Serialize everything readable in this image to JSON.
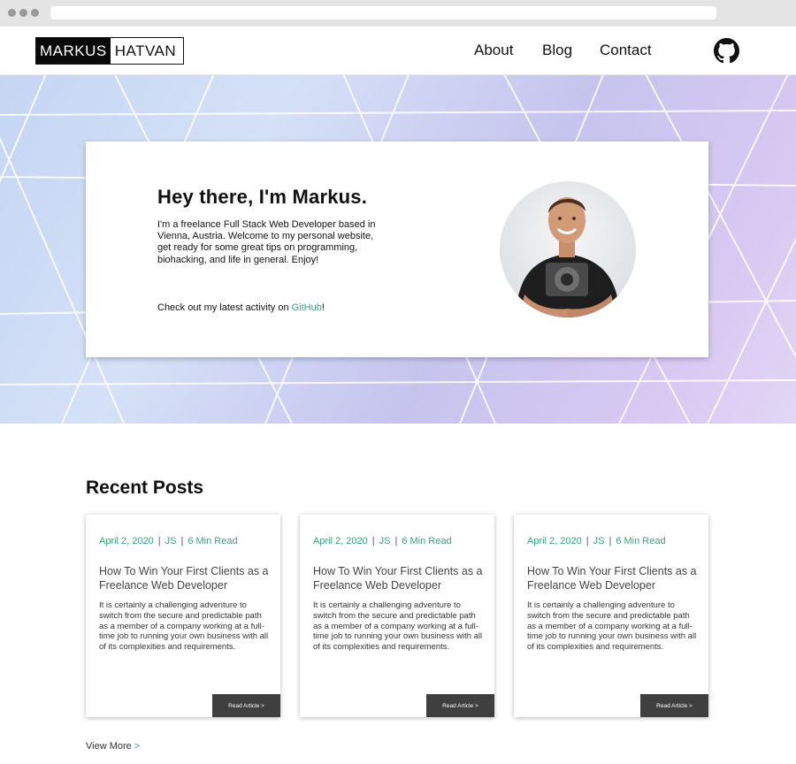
{
  "header": {
    "logo_first": "MARKUS",
    "logo_last": "HATVAN",
    "nav": [
      {
        "label": "About"
      },
      {
        "label": "Blog"
      },
      {
        "label": "Contact"
      }
    ],
    "github_icon": "github-icon"
  },
  "hero": {
    "title": "Hey there, I'm Markus.",
    "intro": "I'm a freelance Full Stack Web Developer based in Vienna, Austria. Welcome to my personal website, get ready for some great tips on programming, biohacking, and life in general. Enjoy!",
    "cta_prefix": "Check out my latest activity on ",
    "cta_link": "GitHub",
    "cta_suffix": "!"
  },
  "posts_section": {
    "title": "Recent Posts",
    "posts": [
      {
        "date": "April 2, 2020",
        "tag": "JS",
        "read_time": "6 Min Read",
        "title": "How To Win Your First Clients as a Freelance Web Developer",
        "excerpt": "It is certainly a challenging adventure to switch from the secure and predictable path as a member of a company working at a full-time job to running your own business with all of its complexities and requirements.",
        "button": "Read Article >"
      },
      {
        "date": "April 2, 2020",
        "tag": "JS",
        "read_time": "6 Min Read",
        "title": "How To Win Your First Clients as a Freelance Web Developer",
        "excerpt": "It is certainly a challenging adventure to switch from the secure and predictable path as a member of a company working at a full-time job to running your own business with all of its complexities and requirements.",
        "button": "Read Article >"
      },
      {
        "date": "April 2, 2020",
        "tag": "JS",
        "read_time": "6 Min Read",
        "title": "How To Win Your First Clients as a Freelance Web Developer",
        "excerpt": "It is certainly a challenging adventure to switch from the secure and predictable path as a member of a company working at a full-time job to running your own business with all of its complexities and requirements.",
        "button": "Read Article >"
      }
    ],
    "view_more": "View More",
    "view_more_arrow": ">"
  },
  "colors": {
    "accent": "#3aa37a",
    "button": "#3f3f3f"
  }
}
